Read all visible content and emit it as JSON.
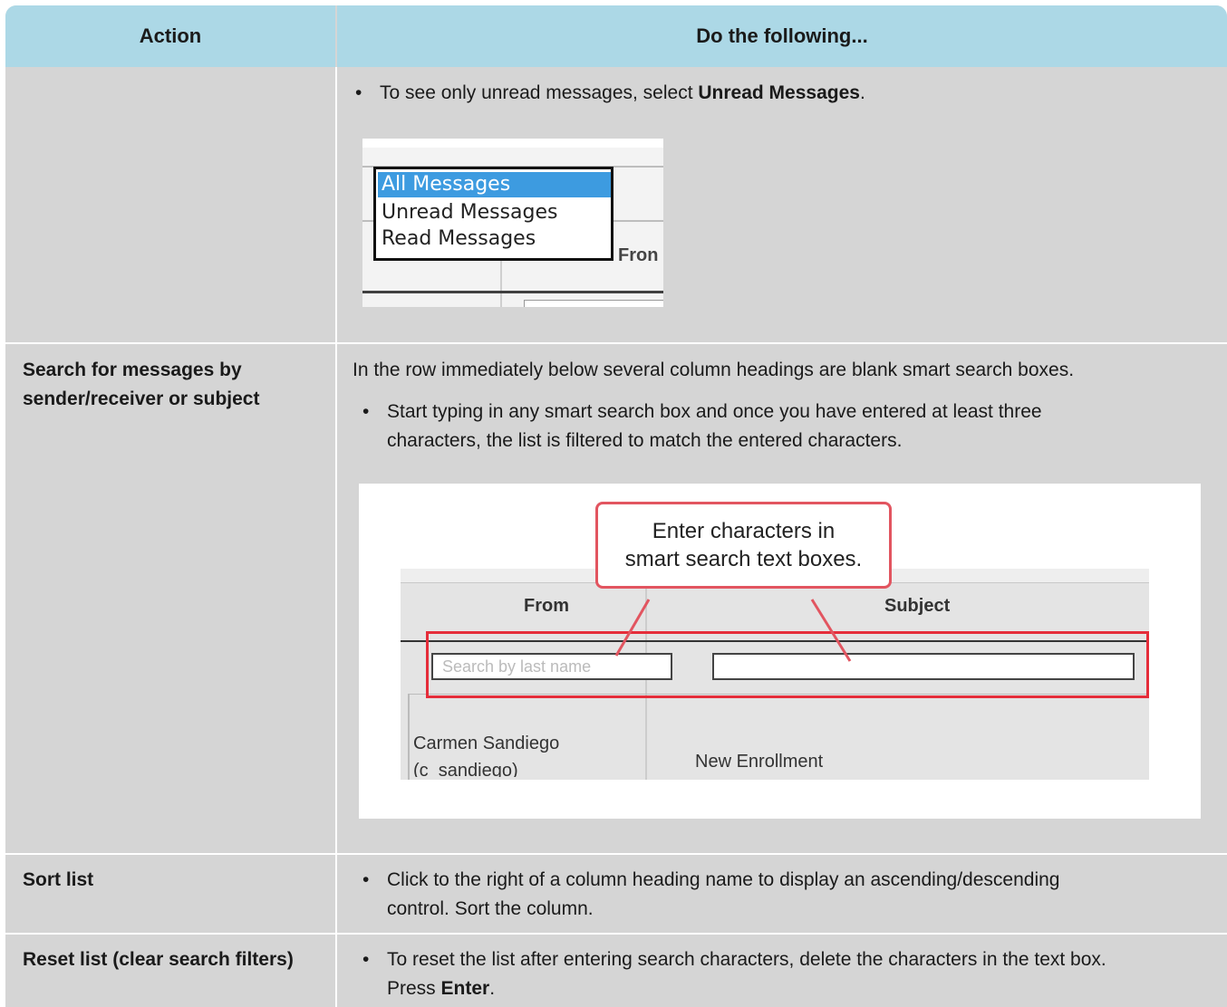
{
  "header": {
    "action": "Action",
    "do": "Do the following..."
  },
  "row1": {
    "bullet": "To see only unread messages, select ",
    "bullet_bold": "Unread Messages",
    "bullet_end": ".",
    "image": {
      "options": [
        "All Messages",
        "Unread Messages",
        "Read Messages"
      ],
      "selected": "All Messages",
      "from_label": "Fron"
    }
  },
  "row2": {
    "action_line1": "Search for messages by",
    "action_line2": "sender/receiver or subject",
    "intro": "In the row immediately below several column headings are blank smart search boxes.",
    "bullet_line1": "Start typing in any smart search box and once you have entered at least three",
    "bullet_line2": "characters, the list is filtered to match the entered characters.",
    "image": {
      "callout_line1": "Enter characters in",
      "callout_line2": "smart search text boxes.",
      "col_from": "From",
      "col_subject": "Subject",
      "search_placeholder": "Search by last name",
      "sender_name": "Carmen Sandiego",
      "sender_user": "(c_sandiego)",
      "subject_value": "New Enrollment"
    }
  },
  "row3": {
    "action": "Sort list",
    "bullet_line1": "Click to the right of a column heading name to display an ascending/descending",
    "bullet_line2": "control. Sort the column."
  },
  "row4": {
    "action": "Reset list (clear search filters)",
    "bullet_line1": "To reset the list after entering search characters, delete the characters in the text box.",
    "bullet_line2_pre": "Press ",
    "bullet_line2_bold": "Enter",
    "bullet_line2_end": "."
  },
  "colors": {
    "header_bg": "#acd8e6",
    "cell_bg": "#d5d5d5",
    "highlight_red": "#e52d3a",
    "select_blue": "#3d9be0"
  }
}
